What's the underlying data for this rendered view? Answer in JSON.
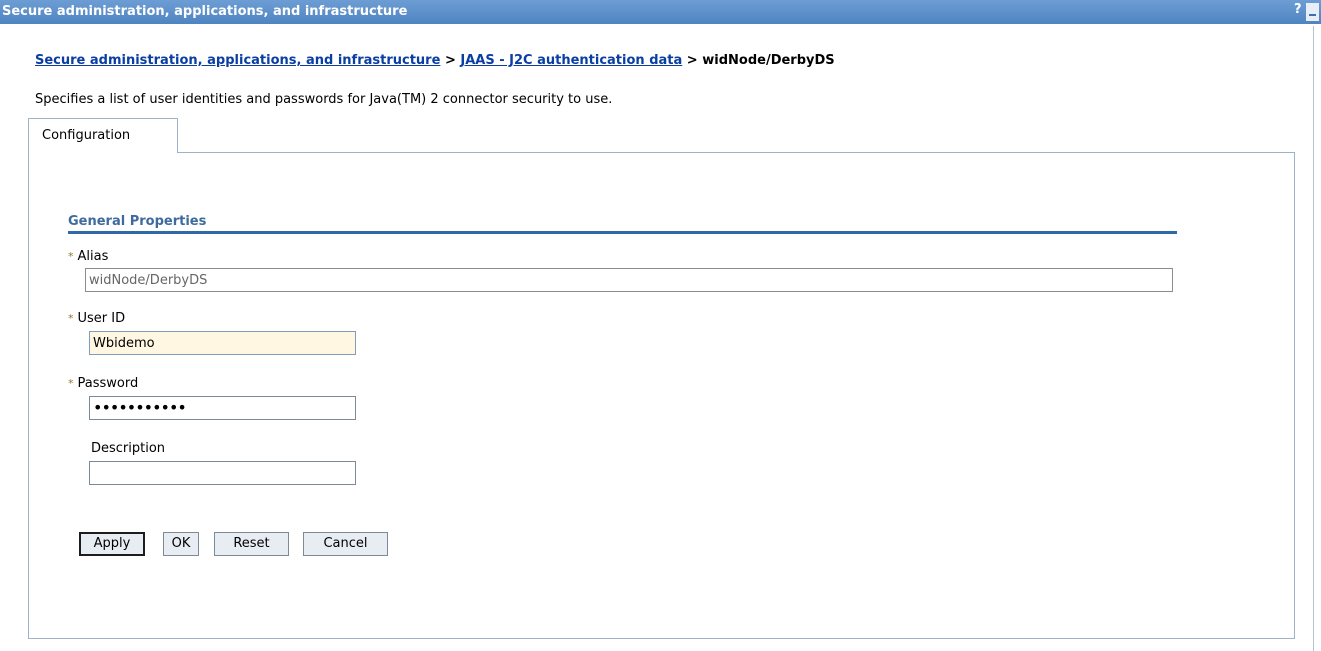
{
  "window": {
    "title": "Secure administration, applications, and infrastructure",
    "help_label": "?",
    "minimize_icon": "minimize-icon"
  },
  "breadcrumb": {
    "items": [
      "Secure administration, applications, and infrastructure",
      "JAAS - J2C authentication data"
    ],
    "separator": ">",
    "current": "widNode/DerbyDS"
  },
  "description": "Specifies a list of user identities and passwords for Java(TM) 2 connector security to use.",
  "tabs": [
    {
      "label": "Configuration",
      "active": true
    }
  ],
  "section": {
    "title": "General Properties"
  },
  "form": {
    "required_marker": "*",
    "alias": {
      "label": "Alias",
      "value": "widNode/DerbyDS",
      "required": true
    },
    "user_id": {
      "label": "User ID",
      "value": "Wbidemo",
      "required": true
    },
    "password": {
      "label": "Password",
      "value": "•••••••••••",
      "required": true
    },
    "description": {
      "label": "Description",
      "value": "",
      "required": false
    }
  },
  "buttons": {
    "apply": "Apply",
    "ok": "OK",
    "reset": "Reset",
    "cancel": "Cancel"
  },
  "colors": {
    "titlebar": "#5a8fc9",
    "link": "#0a3ea3",
    "section_title": "#3e6b9c",
    "focused_input": "#fff7e2"
  }
}
